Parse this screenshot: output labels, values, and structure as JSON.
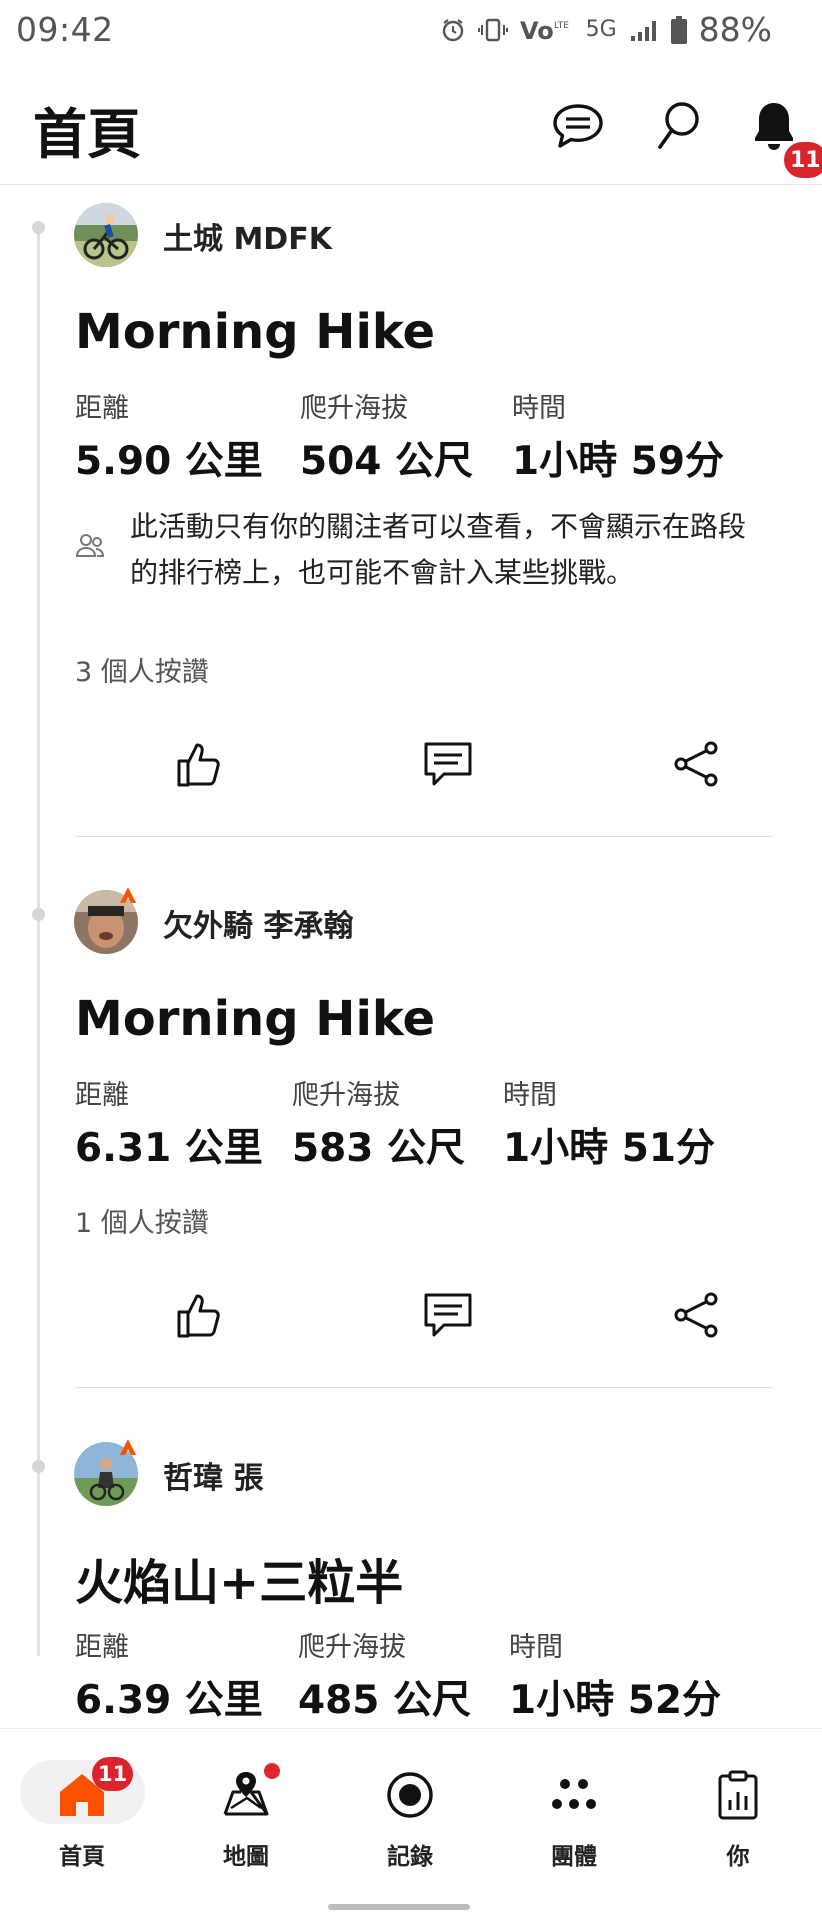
{
  "status_bar": {
    "time": "09:42",
    "battery": "88%",
    "network": "5G",
    "icons": [
      "alarm-icon",
      "vibrate-icon",
      "volte-icon",
      "signal-icon",
      "battery-icon"
    ]
  },
  "header": {
    "title": "首頁",
    "notification_count": "11",
    "icons": [
      "chat-icon",
      "search-icon",
      "bell-icon"
    ]
  },
  "feed": [
    {
      "athlete": "土城 MDFK",
      "title": "Morning Hike",
      "stats": [
        {
          "label": "距離",
          "value": "5.90 公里"
        },
        {
          "label": "爬升海拔",
          "value": "504 公尺"
        },
        {
          "label": "時間",
          "value": "1小時 59分"
        }
      ],
      "privacy_note": "此活動只有你的關注者可以查看，不會顯示在路段的排行榜上，也可能不會計入某些挑戰。",
      "kudos": "3 個人按讚"
    },
    {
      "athlete": "欠外騎 李承翰",
      "title": "Morning Hike",
      "stats": [
        {
          "label": "距離",
          "value": "6.31 公里"
        },
        {
          "label": "爬升海拔",
          "value": "583 公尺"
        },
        {
          "label": "時間",
          "value": "1小時 51分"
        }
      ],
      "kudos": "1 個人按讚"
    },
    {
      "athlete": "哲瑋 張",
      "title": "火焰山+三粒半",
      "stats": [
        {
          "label": "距離",
          "value": "6.39 公里"
        },
        {
          "label": "爬升海拔",
          "value": "485 公尺"
        },
        {
          "label": "時間",
          "value": "1小時 52分"
        }
      ]
    }
  ],
  "bottom_nav": {
    "items": [
      {
        "label": "首頁",
        "icon": "home-icon",
        "badge": "11",
        "active": true
      },
      {
        "label": "地圖",
        "icon": "map-icon",
        "dot": true
      },
      {
        "label": "記錄",
        "icon": "record-icon"
      },
      {
        "label": "團體",
        "icon": "groups-icon"
      },
      {
        "label": "你",
        "icon": "profile-icon"
      }
    ]
  },
  "colors": {
    "brand_orange": "#fc5200",
    "badge_red": "#d9232d",
    "text_primary": "#111111",
    "divider": "#e2e2e2"
  }
}
